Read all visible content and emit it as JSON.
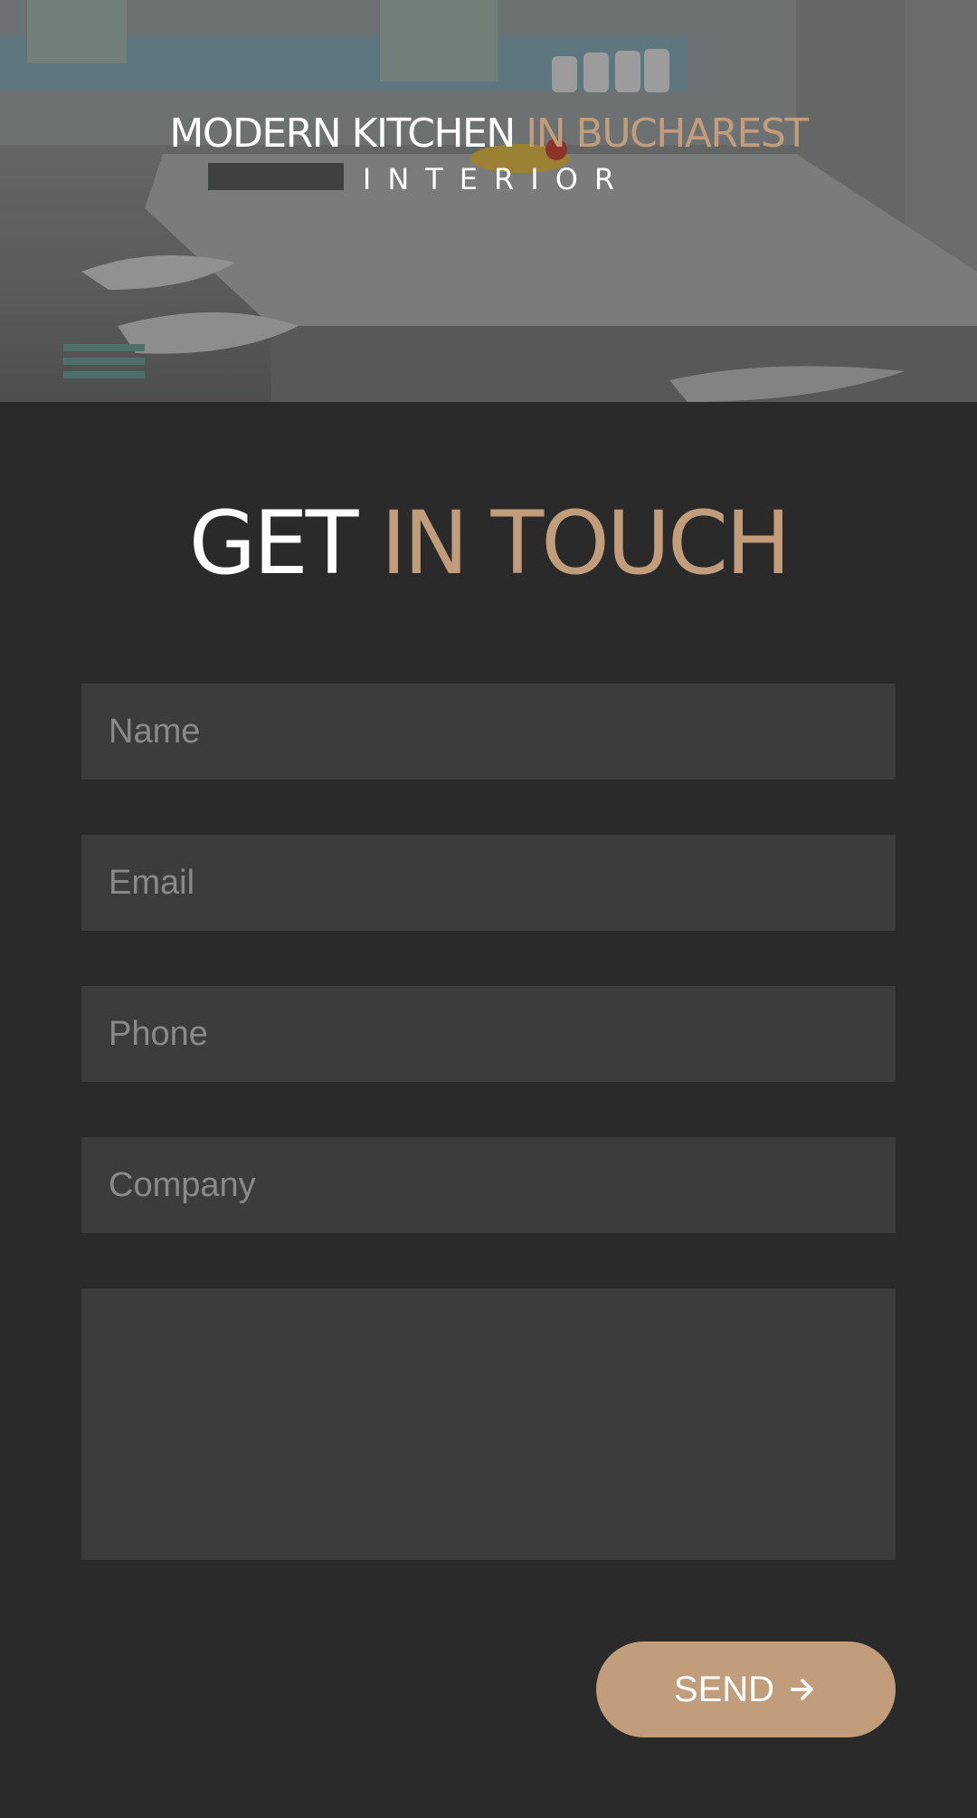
{
  "hero": {
    "title_main": "MODERN KITCHEN",
    "title_accent": "IN BUCHAREST",
    "subtitle": "INTERIOR"
  },
  "contact": {
    "heading_main": "GET",
    "heading_accent": "IN TOUCH",
    "fields": {
      "name_placeholder": "Name",
      "email_placeholder": "Email",
      "phone_placeholder": "Phone",
      "company_placeholder": "Company",
      "message_placeholder": ""
    },
    "send_label": "SEND",
    "send_icon": "arrow-right-icon"
  },
  "colors": {
    "background": "#2a2a2a",
    "field_background": "#3c3c3c",
    "accent": "#c19d7b",
    "text": "#ffffff",
    "placeholder": "#8a8a8a"
  }
}
